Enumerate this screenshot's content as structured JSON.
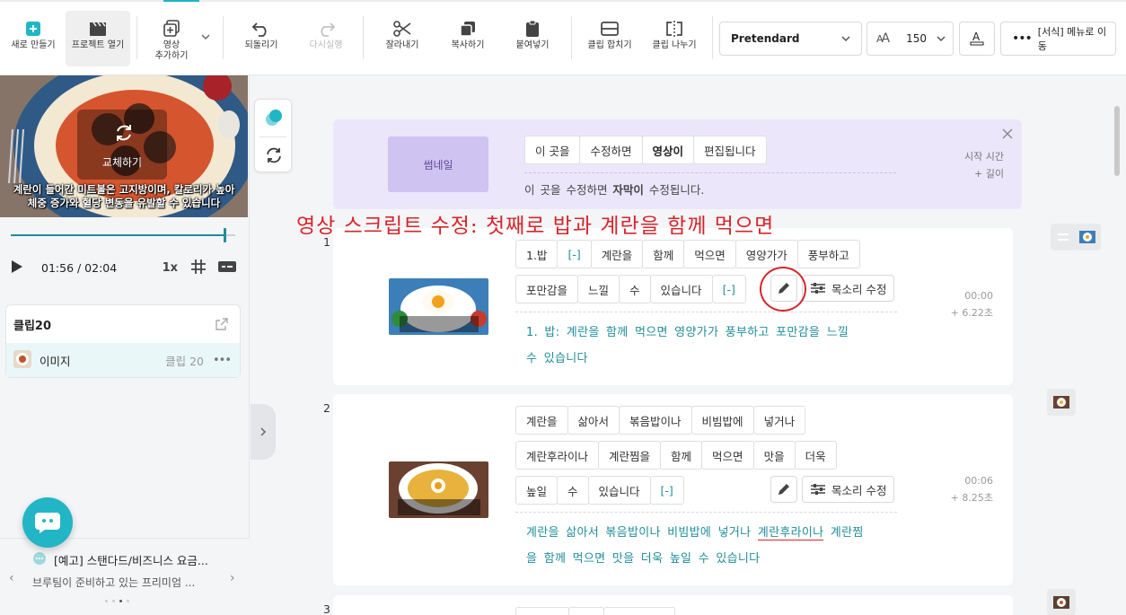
{
  "toolbar": {
    "new_label": "새로 만들기",
    "open_label": "프로젝트 열기",
    "add_video_line1": "영상",
    "add_video_line2": "추가하기",
    "undo_label": "되돌리기",
    "redo_label": "다시실행",
    "cut_label": "잘라내기",
    "copy_label": "복사하기",
    "paste_label": "붙여넣기",
    "merge_label": "클립 합치기",
    "split_label": "클립 나누기",
    "font_name": "Pretendard",
    "font_size": "150",
    "menu_label": "[서식] 메뉴로 이동",
    "accent_color": "#1fb7c6"
  },
  "preview": {
    "replace_label": "교체하기",
    "subtitle_line1": "계란이 들어간 미트볼은 고지방이며, 칼로리가 높아",
    "subtitle_line2": "체중 증가와 혈당 변동을 유발할 수 있습니다",
    "time": "01:56 / 02:04",
    "speed": "1x",
    "progress": 0.95
  },
  "clip": {
    "title": "클립20",
    "item_label": "이미지",
    "item_clip": "클립 20"
  },
  "notice": {
    "title": "[예고] 스탠다드/비즈니스 요금...",
    "body": "브루팀이 준비하고 있는 프리미엄 ..."
  },
  "hint": {
    "thumb_label": "썸네일",
    "words": [
      "이 곳을",
      "수정하면",
      "영상이",
      "편집됩니다"
    ],
    "caption_prefix": "이 곳을 수정하면 ",
    "caption_bold": "자막이",
    "caption_suffix": " 수정됩니다.",
    "time_label": "시작 시간",
    "len_label": "+ 길이"
  },
  "annotation": "영상 스크립트 수정: 첫째로 밥과 계란을 함께 먹으면",
  "voice_label": "목소리 수정",
  "scenes": [
    {
      "num": "1",
      "row1": [
        "1.밥",
        "[-]",
        "계란을",
        "함께",
        "먹으면",
        "영양가가",
        "풍부하고"
      ],
      "row2": [
        "포만감을",
        "느낄",
        "수",
        "있습니다",
        "[-]"
      ],
      "caption_line1": "1.  밥: 계란을 함께 먹으면 영양가가 풍부하고 포만감을 느낄",
      "caption_line2": "수 있습니다",
      "start": "00:00",
      "length": "+ 6.22초"
    },
    {
      "num": "2",
      "row1": [
        "계란을",
        "삶아서",
        "볶음밥이나",
        "비빔밥에",
        "넣거나"
      ],
      "row2": [
        "계란후라이나",
        "계란찜을",
        "함께",
        "먹으면",
        "맛을",
        "더욱"
      ],
      "row3": [
        "높일",
        "수",
        "있습니다",
        "[-]"
      ],
      "caption_line1a": "계란을 삶아서 볶음밥이나 비빔밥에 넣거나 ",
      "caption_line1b": "계란후라이나",
      "caption_line1c": " 계란찜",
      "caption_line2": "을 함께 먹으면 맛을 더욱 높일 수 있습니다",
      "start": "00:06",
      "length": "+ 8.25초"
    },
    {
      "num": "3"
    }
  ]
}
